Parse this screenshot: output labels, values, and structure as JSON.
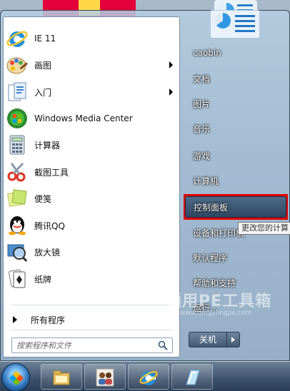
{
  "left_pane": {
    "programs": [
      {
        "label": "IE 11",
        "icon": "ie-icon",
        "has_submenu": false
      },
      {
        "label": "画图",
        "icon": "paint-icon",
        "has_submenu": true
      },
      {
        "label": "入门",
        "icon": "getting-started-icon",
        "has_submenu": true
      },
      {
        "label": "Windows Media Center",
        "icon": "media-center-icon",
        "has_submenu": false
      },
      {
        "label": "计算器",
        "icon": "calculator-icon",
        "has_submenu": false
      },
      {
        "label": "截图工具",
        "icon": "snipping-tool-icon",
        "has_submenu": false
      },
      {
        "label": "便笺",
        "icon": "sticky-notes-icon",
        "has_submenu": false
      },
      {
        "label": "腾讯QQ",
        "icon": "qq-icon",
        "has_submenu": false
      },
      {
        "label": "放大镜",
        "icon": "magnifier-icon",
        "has_submenu": false
      },
      {
        "label": "纸牌",
        "icon": "solitaire-icon",
        "has_submenu": false
      }
    ],
    "all_programs": "所有程序",
    "search_placeholder": "搜索程序和文件"
  },
  "right_pane": {
    "items": [
      {
        "label": "caobin"
      },
      {
        "label": "文档"
      },
      {
        "label": "图片"
      },
      {
        "label": "音乐"
      },
      {
        "label": "游戏"
      },
      {
        "label": "计算机"
      },
      {
        "label": "控制面板",
        "highlighted": true
      },
      {
        "label": "设备和打印机"
      },
      {
        "label": "默认程序"
      },
      {
        "label": "帮助和支持"
      },
      {
        "label": "运行..."
      }
    ],
    "tooltip": "更改您的计算",
    "shutdown_label": "关机"
  },
  "watermark": {
    "title": "通用PE工具箱",
    "url": "www.tongyongpe.com"
  },
  "colors": {
    "highlight_box": "#e10000",
    "taskbar": "#3b506a"
  },
  "taskbar": {
    "icons": [
      "start-orb",
      "file-explorer-icon",
      "contacts-icon",
      "ie-icon",
      "app-icon"
    ]
  }
}
